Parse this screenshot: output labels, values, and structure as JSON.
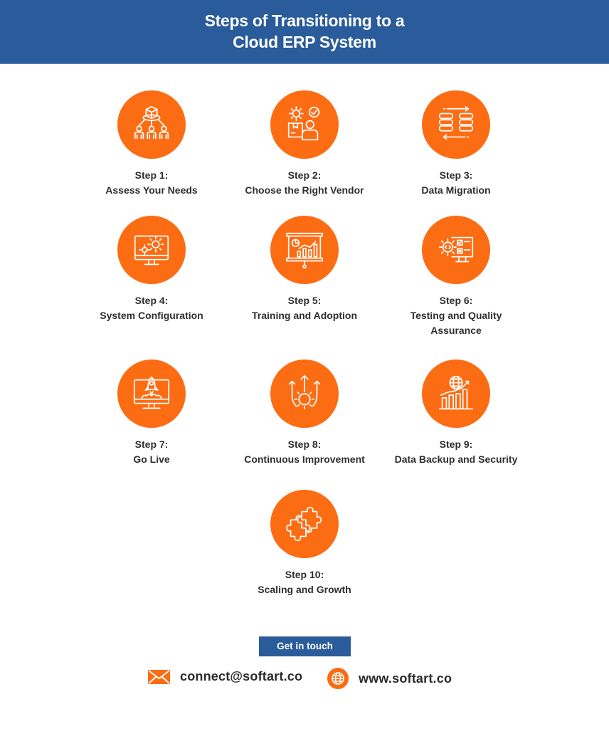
{
  "header": {
    "title_line1": "Steps of Transitioning to a",
    "title_line2": "Cloud ERP System"
  },
  "colors": {
    "brand_blue": "#2a5b9a",
    "accent_orange": "#fc6c13"
  },
  "steps": [
    {
      "step": "Step 1:",
      "title": "Assess Your Needs",
      "icon": "hierarchy-people-icon"
    },
    {
      "step": "Step 2:",
      "title": "Choose the Right Vendor",
      "icon": "vendor-selection-icon"
    },
    {
      "step": "Step 3:",
      "title": "Data Migration",
      "icon": "data-migration-icon"
    },
    {
      "step": "Step 4:",
      "title": "System Configuration",
      "icon": "system-configuration-icon"
    },
    {
      "step": "Step 5:",
      "title": "Training and Adoption",
      "icon": "training-presentation-icon"
    },
    {
      "step": "Step 6:",
      "title": "Testing and Quality Assurance",
      "icon": "testing-qa-icon"
    },
    {
      "step": "Step 7:",
      "title": "Go Live",
      "icon": "rocket-launch-icon"
    },
    {
      "step": "Step 8:",
      "title": "Continuous Improvement",
      "icon": "gear-arrows-up-icon"
    },
    {
      "step": "Step 9:",
      "title": "Data Backup and Security",
      "icon": "globe-growth-chart-icon"
    },
    {
      "step": "Step 10:",
      "title": "Scaling and Growth",
      "icon": "puzzle-pieces-icon"
    }
  ],
  "cta": {
    "label": "Get in touch"
  },
  "contact": {
    "email": "connect@softart.co",
    "website": "www.softart.co"
  }
}
